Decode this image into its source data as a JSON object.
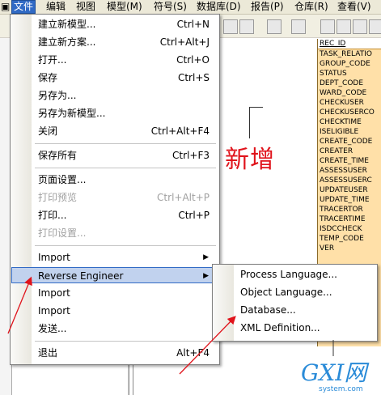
{
  "menubar": {
    "items": [
      "文件",
      "编辑",
      "视图",
      "模型(M)",
      "符号(S)",
      "数据库(D)",
      "报告(P)",
      "仓库(R)",
      "查看(V)"
    ]
  },
  "file_menu": {
    "items": [
      {
        "label": "建立新模型...",
        "shortcut": "Ctrl+N",
        "disabled": false
      },
      {
        "label": "建立新方案...",
        "shortcut": "Ctrl+Alt+J",
        "disabled": false
      },
      {
        "label": "打开...",
        "shortcut": "Ctrl+O",
        "disabled": false
      },
      {
        "label": "保存",
        "shortcut": "Ctrl+S",
        "disabled": false
      },
      {
        "label": "另存为...",
        "shortcut": "",
        "disabled": false
      },
      {
        "label": "另存为新模型...",
        "shortcut": "",
        "disabled": false
      },
      {
        "label": "关闭",
        "shortcut": "Ctrl+Alt+F4",
        "disabled": false
      },
      {
        "label": "保存所有",
        "shortcut": "Ctrl+F3",
        "disabled": false
      },
      {
        "label": "页面设置...",
        "shortcut": "",
        "disabled": false
      },
      {
        "label": "打印预览",
        "shortcut": "Ctrl+Alt+P",
        "disabled": true
      },
      {
        "label": "打印...",
        "shortcut": "Ctrl+P",
        "disabled": false
      },
      {
        "label": "打印设置...",
        "shortcut": "",
        "disabled": true
      },
      {
        "label": "Import",
        "shortcut": "",
        "disabled": false
      },
      {
        "label": "Reverse Engineer",
        "shortcut": "",
        "disabled": false
      },
      {
        "label": "Import",
        "shortcut": "",
        "disabled": false
      },
      {
        "label": "Import",
        "shortcut": "",
        "disabled": false
      },
      {
        "label": "发送...",
        "shortcut": "",
        "disabled": false
      },
      {
        "label": "退出",
        "shortcut": "Alt+F4",
        "disabled": false
      }
    ]
  },
  "reverse_submenu": {
    "items": [
      "Process Language...",
      "Object Language...",
      "Database...",
      "XML Definition..."
    ]
  },
  "entity": {
    "header": "REC_ID",
    "columns": [
      "TASK_RELATIO",
      "GROUP_CODE",
      "STATUS",
      "DEPT_CODE",
      "WARD_CODE",
      "CHECKUSER",
      "CHECKUSERCO",
      "CHECKTIME",
      "ISELIGIBLE",
      "CREATE_CODE",
      "CREATER",
      "CREATE_TIME",
      "ASSESSUSER",
      "ASSESSUSERC",
      "UPDATEUSER",
      "UPDATE_TIME",
      "TRACERTOR",
      "TRACERTIME",
      "ISDCCHECK",
      "TEMP_CODE",
      "VER"
    ]
  },
  "annotation": {
    "text": "新增",
    "color": "#e0131b"
  },
  "watermark": {
    "big": "GXI网",
    "small": "system.com"
  },
  "colors": {
    "highlight": "#c1d2ee",
    "highlight_border": "#316ac5",
    "entity_fill": "#ffe0a8",
    "arrow": "#e0131b"
  }
}
